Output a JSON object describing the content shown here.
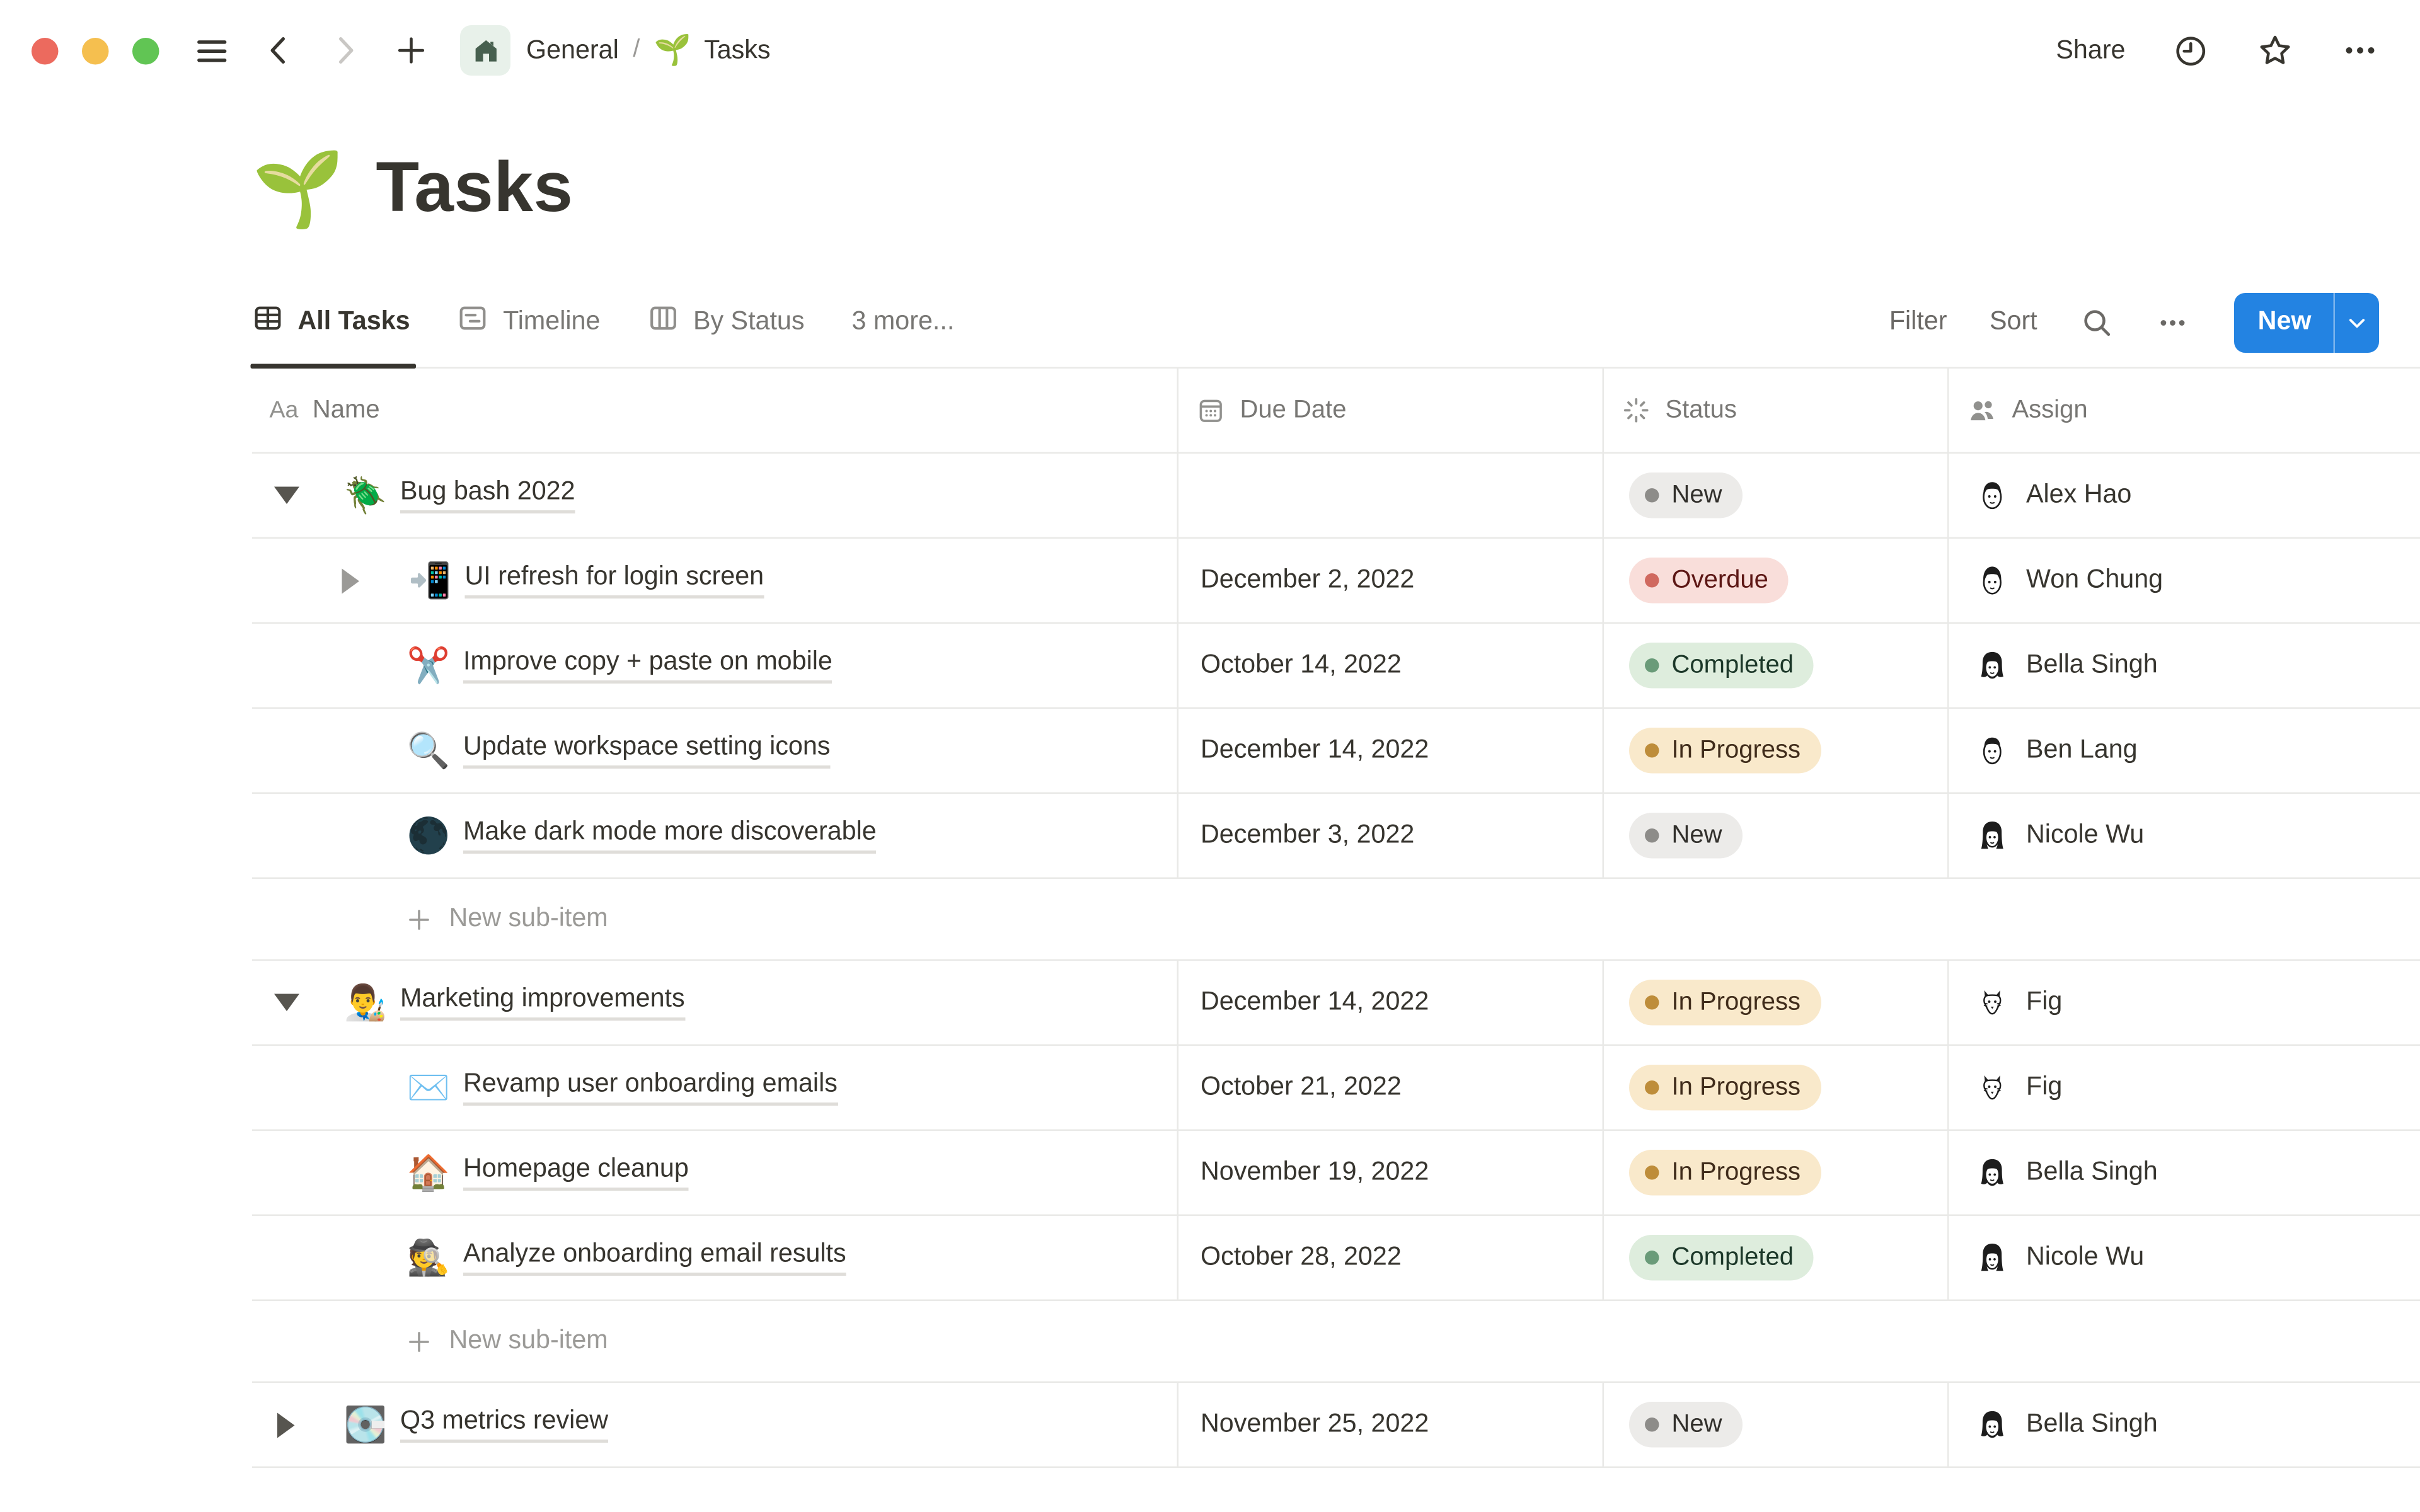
{
  "window": {
    "breadcrumb": {
      "home_label": "General",
      "separator": "/",
      "page_emoji": "🌱",
      "page_label": "Tasks"
    },
    "share_label": "Share"
  },
  "page": {
    "title_emoji": "🌱",
    "title": "Tasks"
  },
  "views": {
    "tabs": [
      {
        "label": "All Tasks",
        "icon": "table-view-icon",
        "active": true
      },
      {
        "label": "Timeline",
        "icon": "timeline-view-icon",
        "active": false
      },
      {
        "label": "By Status",
        "icon": "board-view-icon",
        "active": false
      }
    ],
    "more_label": "3 more..."
  },
  "toolbar": {
    "filter_label": "Filter",
    "sort_label": "Sort",
    "new_label": "New"
  },
  "table": {
    "columns": [
      {
        "label": "Name",
        "icon": "text-icon"
      },
      {
        "label": "Due Date",
        "icon": "calendar-icon"
      },
      {
        "label": "Status",
        "icon": "status-spinner-icon"
      },
      {
        "label": "Assign",
        "icon": "people-icon"
      }
    ]
  },
  "rows": [
    {
      "type": "item",
      "level": 0,
      "toggle": "down",
      "toggle_tone": "dark",
      "icon": "🪲",
      "name": "Bug bash 2022",
      "due": "",
      "status": "New",
      "status_type": "gray",
      "assignee": "Alex Hao",
      "avatar": "#av-man-short"
    },
    {
      "type": "item",
      "level": 1,
      "toggle": "right",
      "toggle_tone": "gray",
      "icon": "📲",
      "name": "UI refresh for login screen",
      "due": "December 2, 2022",
      "status": "Overdue",
      "status_type": "red",
      "assignee": "Won Chung",
      "avatar": "#av-man-bowl"
    },
    {
      "type": "item",
      "level": 1,
      "toggle": "none",
      "toggle_tone": "dark",
      "icon": "✂️",
      "name": "Improve copy + paste on mobile",
      "due": "October 14, 2022",
      "status": "Completed",
      "status_type": "green",
      "assignee": "Bella Singh",
      "avatar": "#av-woman-bob"
    },
    {
      "type": "item",
      "level": 1,
      "toggle": "none",
      "toggle_tone": "dark",
      "icon": "🔍",
      "name": "Update workspace setting icons",
      "due": "December 14, 2022",
      "status": "In Progress",
      "status_type": "yellow",
      "assignee": "Ben Lang",
      "avatar": "#av-man-flat"
    },
    {
      "type": "item",
      "level": 1,
      "toggle": "none",
      "toggle_tone": "dark",
      "icon": "🌑",
      "name": "Make dark mode more discoverable",
      "due": "December 3, 2022",
      "status": "New",
      "status_type": "gray",
      "assignee": "Nicole Wu",
      "avatar": "#av-woman-long"
    },
    {
      "type": "add",
      "label": "New sub-item"
    },
    {
      "type": "item",
      "level": 0,
      "toggle": "down",
      "toggle_tone": "dark",
      "icon": "👨‍🎨",
      "name": "Marketing improvements",
      "due": "December 14, 2022",
      "status": "In Progress",
      "status_type": "yellow",
      "assignee": "Fig",
      "avatar": "#av-dog"
    },
    {
      "type": "item",
      "level": 1,
      "toggle": "none",
      "toggle_tone": "dark",
      "icon": "✉️",
      "name": "Revamp user onboarding emails",
      "due": "October 21, 2022",
      "status": "In Progress",
      "status_type": "yellow",
      "assignee": "Fig",
      "avatar": "#av-dog"
    },
    {
      "type": "item",
      "level": 1,
      "toggle": "none",
      "toggle_tone": "dark",
      "icon": "🏠",
      "name": "Homepage cleanup",
      "due": "November 19, 2022",
      "status": "In Progress",
      "status_type": "yellow",
      "assignee": "Bella Singh",
      "avatar": "#av-woman-bob"
    },
    {
      "type": "item",
      "level": 1,
      "toggle": "none",
      "toggle_tone": "dark",
      "icon": "🕵️",
      "name": "Analyze onboarding email results",
      "due": "October 28, 2022",
      "status": "Completed",
      "status_type": "green",
      "assignee": "Nicole Wu",
      "avatar": "#av-woman-long"
    },
    {
      "type": "add",
      "label": "New sub-item"
    },
    {
      "type": "item",
      "level": 0,
      "toggle": "right",
      "toggle_tone": "dark",
      "icon": "💽",
      "name": "Q3 metrics review",
      "due": "November 25, 2022",
      "status": "New",
      "status_type": "gray",
      "assignee": "Bella Singh",
      "avatar": "#av-woman-bob"
    }
  ],
  "colors": {
    "accent_blue": "#2383E2",
    "text_primary": "#37352F",
    "text_secondary": "#787774",
    "row_border": "#E9E9E7",
    "status_gray_bg": "#ECEBE9",
    "status_gray_dot": "#8D8C89",
    "status_red_bg": "#F9DEDA",
    "status_red_dot": "#D0695F",
    "status_red_text": "#5D1715",
    "status_green_bg": "#DEEDDD",
    "status_green_dot": "#6A9B79",
    "status_green_text": "#1C3829",
    "status_yellow_bg": "#F9E9CB",
    "status_yellow_dot": "#BE8D3A",
    "status_yellow_text": "#402C1B"
  }
}
